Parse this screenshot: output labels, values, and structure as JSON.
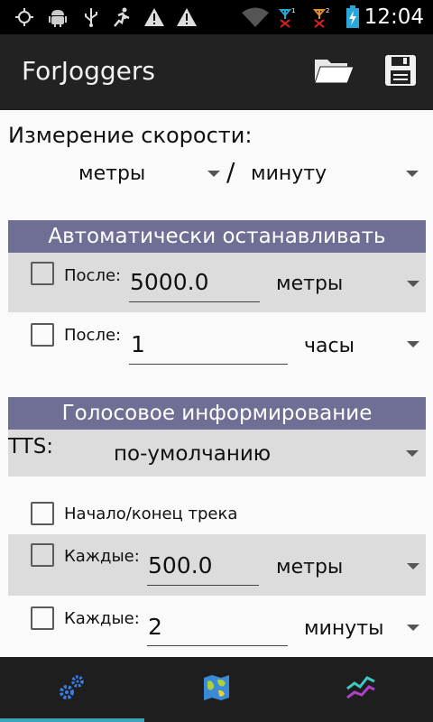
{
  "status_bar": {
    "time": "12:04",
    "icons": [
      "gps-icon",
      "android-icon",
      "usb-icon",
      "runner-icon",
      "warning-icon",
      "warning-icon",
      "wifi-icon",
      "signal-1-icon",
      "signal-2-icon",
      "battery-charging-icon"
    ]
  },
  "action_bar": {
    "title": "ForJoggers",
    "open_icon": "folder-open-icon",
    "save_icon": "save-icon"
  },
  "speed": {
    "label": "Измерение скорости:",
    "unit_distance": "метры",
    "separator": "/",
    "unit_time": "минуту"
  },
  "auto_stop": {
    "header": "Автоматически останавливать",
    "rows": [
      {
        "label": "После:",
        "value": "5000.0",
        "unit": "метры",
        "checked": false
      },
      {
        "label": "После:",
        "value": "1",
        "unit": "часы",
        "checked": false
      }
    ]
  },
  "voice": {
    "header": "Голосовое информирование",
    "tts_label": "TTS:",
    "tts_value": "по-умолчанию",
    "track_label": "Начало/конец трека",
    "rows": [
      {
        "label": "Каждые:",
        "value": "500.0",
        "unit": "метры",
        "checked": false
      },
      {
        "label": "Каждые:",
        "value": "2",
        "unit": "минуты",
        "checked": false
      }
    ]
  },
  "bottom_nav": {
    "tabs": [
      "settings-gears-icon",
      "map-icon",
      "chart-icon"
    ],
    "active_tab": 0,
    "accent": "#3aa8b8"
  }
}
